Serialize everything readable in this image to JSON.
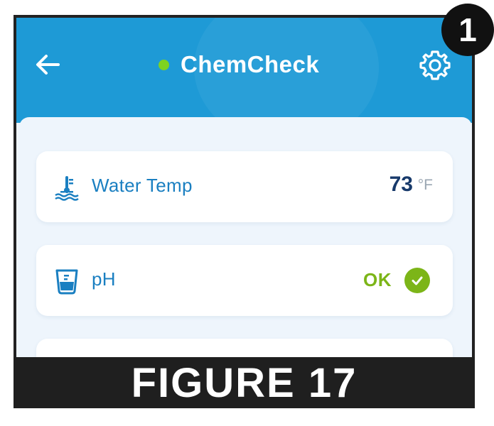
{
  "header": {
    "title": "ChemCheck",
    "back_icon": "arrow-left-icon",
    "settings_icon": "gear-icon",
    "status_color": "#7ed321",
    "bar_color": "#1e9ad6"
  },
  "cards": [
    {
      "icon": "water-temperature-icon",
      "label": "Water Temp",
      "value": "73",
      "unit": "°F"
    },
    {
      "icon": "beaker-icon",
      "label": "pH",
      "status": "OK",
      "status_icon": "check-circle-icon",
      "status_color": "#7cb518"
    }
  ],
  "annotation": {
    "badge_number": "1",
    "caption": "FIGURE 17"
  }
}
